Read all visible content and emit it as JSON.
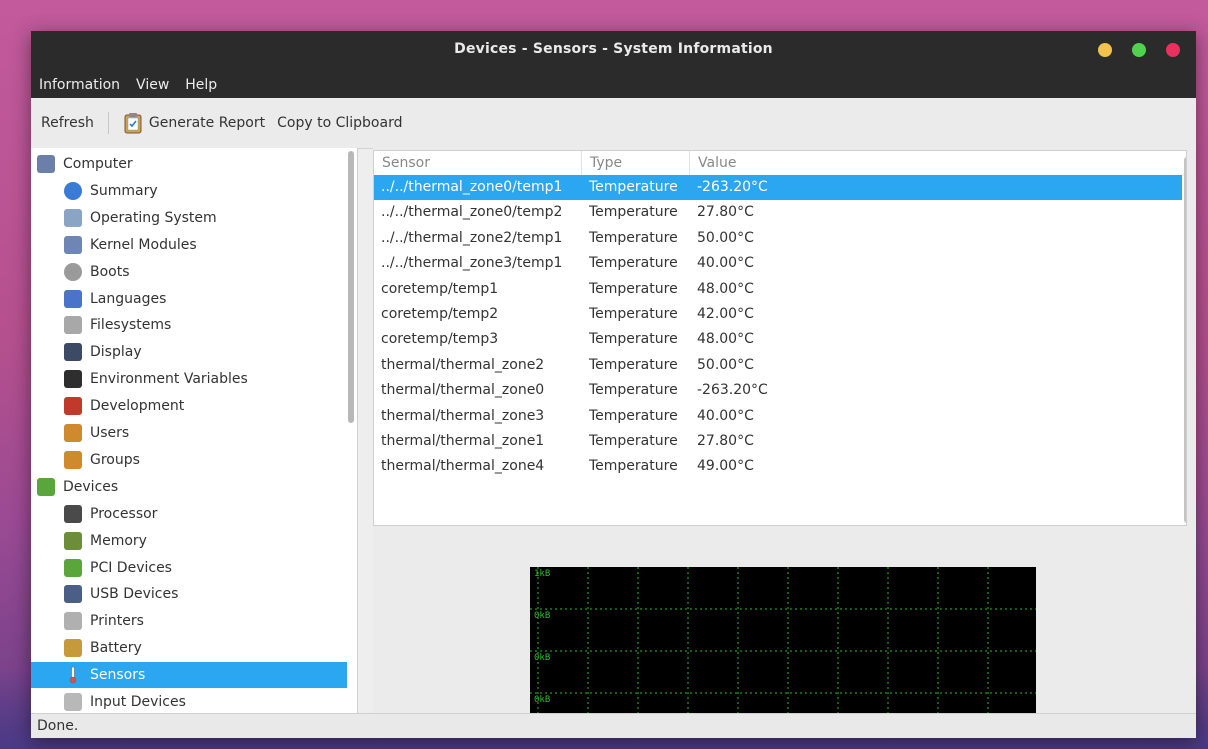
{
  "window": {
    "title": "Devices - Sensors - System Information"
  },
  "menubar": {
    "items": [
      "Information",
      "View",
      "Help"
    ]
  },
  "toolbar": {
    "refresh": "Refresh",
    "generate_report": "Generate Report",
    "copy": "Copy to Clipboard"
  },
  "sidebar": {
    "items": [
      {
        "label": "Computer",
        "icon": "computer-icon",
        "level": 0
      },
      {
        "label": "Summary",
        "icon": "info-icon",
        "level": 1
      },
      {
        "label": "Operating System",
        "icon": "gear-icon",
        "level": 1
      },
      {
        "label": "Kernel Modules",
        "icon": "module-icon",
        "level": 1
      },
      {
        "label": "Boots",
        "icon": "power-icon",
        "level": 1
      },
      {
        "label": "Languages",
        "icon": "flag-icon",
        "level": 1
      },
      {
        "label": "Filesystems",
        "icon": "drive-icon",
        "level": 1
      },
      {
        "label": "Display",
        "icon": "monitor-icon",
        "level": 1
      },
      {
        "label": "Environment Variables",
        "icon": "terminal-icon",
        "level": 1
      },
      {
        "label": "Development",
        "icon": "development-icon",
        "level": 1
      },
      {
        "label": "Users",
        "icon": "users-icon",
        "level": 1
      },
      {
        "label": "Groups",
        "icon": "groups-icon",
        "level": 1
      },
      {
        "label": "Devices",
        "icon": "devices-icon",
        "level": 0
      },
      {
        "label": "Processor",
        "icon": "processor-icon",
        "level": 1
      },
      {
        "label": "Memory",
        "icon": "memory-icon",
        "level": 1
      },
      {
        "label": "PCI Devices",
        "icon": "pci-icon",
        "level": 1
      },
      {
        "label": "USB Devices",
        "icon": "usb-icon",
        "level": 1
      },
      {
        "label": "Printers",
        "icon": "printer-icon",
        "level": 1
      },
      {
        "label": "Battery",
        "icon": "battery-icon",
        "level": 1
      },
      {
        "label": "Sensors",
        "icon": "thermometer-icon",
        "level": 1,
        "selected": true
      },
      {
        "label": "Input Devices",
        "icon": "input-device-icon",
        "level": 1
      }
    ]
  },
  "table": {
    "headers": [
      "Sensor",
      "Type",
      "Value"
    ],
    "rows": [
      [
        "../../thermal_zone0/temp1",
        "Temperature",
        "-263.20°C"
      ],
      [
        "../../thermal_zone0/temp2",
        "Temperature",
        "27.80°C"
      ],
      [
        "../../thermal_zone2/temp1",
        "Temperature",
        "50.00°C"
      ],
      [
        "../../thermal_zone3/temp1",
        "Temperature",
        "40.00°C"
      ],
      [
        "coretemp/temp1",
        "Temperature",
        "48.00°C"
      ],
      [
        "coretemp/temp2",
        "Temperature",
        "42.00°C"
      ],
      [
        "coretemp/temp3",
        "Temperature",
        "48.00°C"
      ],
      [
        "thermal/thermal_zone2",
        "Temperature",
        "50.00°C"
      ],
      [
        "thermal/thermal_zone0",
        "Temperature",
        "-263.20°C"
      ],
      [
        "thermal/thermal_zone3",
        "Temperature",
        "40.00°C"
      ],
      [
        "thermal/thermal_zone1",
        "Temperature",
        "27.80°C"
      ],
      [
        "thermal/thermal_zone4",
        "Temperature",
        "49.00°C"
      ]
    ],
    "selected_row": 0
  },
  "graph": {
    "labels": [
      "1kB",
      "0kB",
      "0kB",
      "0kB"
    ]
  },
  "status": {
    "text": "Done."
  },
  "colors": {
    "accent": "#2ba6f0",
    "titlebar": "#2b2b2b",
    "graph_grid": "#2dbb2d"
  }
}
